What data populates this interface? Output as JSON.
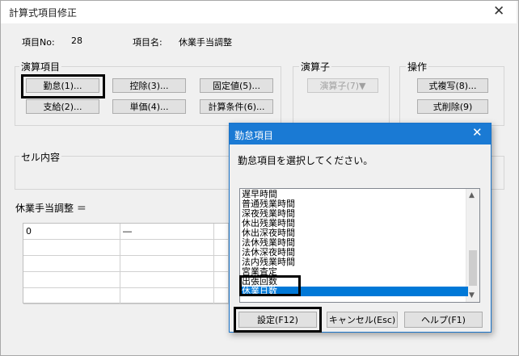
{
  "window": {
    "title": "計算式項目修正",
    "close_glyph": "✕"
  },
  "item": {
    "no_label": "項目No:",
    "no_value": "28",
    "name_label": "項目名:",
    "name_value": "休業手当調整"
  },
  "groups": {
    "operands": "演算項目",
    "operator": "演算子",
    "actions": "操作",
    "cell": "セル内容"
  },
  "operand_buttons": {
    "kintai": "勤怠(1)...",
    "shikyu": "支給(2)...",
    "kojo": "控除(3)...",
    "tanka": "単価(4)...",
    "koteichi": "固定値(5)...",
    "keisan_joken": "計算条件(6)..."
  },
  "operator_button": "演算子(7)▼",
  "action_buttons": {
    "copy": "式複写(8)...",
    "delete": "式削除(9)"
  },
  "formula_label": "休業手当調整 ＝",
  "formula_rows": [
    [
      "0",
      "―",
      "",
      "",
      "",
      ""
    ],
    [
      "",
      "",
      "",
      "",
      "",
      ""
    ],
    [
      "",
      "",
      "",
      "",
      "",
      ""
    ],
    [
      "",
      "",
      "",
      "",
      "",
      ""
    ],
    [
      "",
      "",
      "",
      "",
      "",
      ""
    ]
  ],
  "dialog": {
    "title": "勤怠項目",
    "close_glyph": "✕",
    "prompt": "勤怠項目を選択してください。",
    "items": [
      "遅早時間",
      "普通残業時間",
      "深夜残業時間",
      "休出残業時間",
      "休出深夜時間",
      "法休残業時間",
      "法休深夜時間",
      "法内残業時間",
      "宮業査定",
      "出張回数",
      "休業日数"
    ],
    "selected_index": 10,
    "buttons": {
      "ok": "設定(F12)",
      "cancel": "キャンセル(Esc)",
      "help": "ヘルプ(F1)"
    },
    "scroll_up_glyph": "▲",
    "scroll_down_glyph": "▼"
  },
  "colors": {
    "title_bar": "#1a7ad4",
    "selection": "#0078d7",
    "highlight_box": "#000000"
  }
}
